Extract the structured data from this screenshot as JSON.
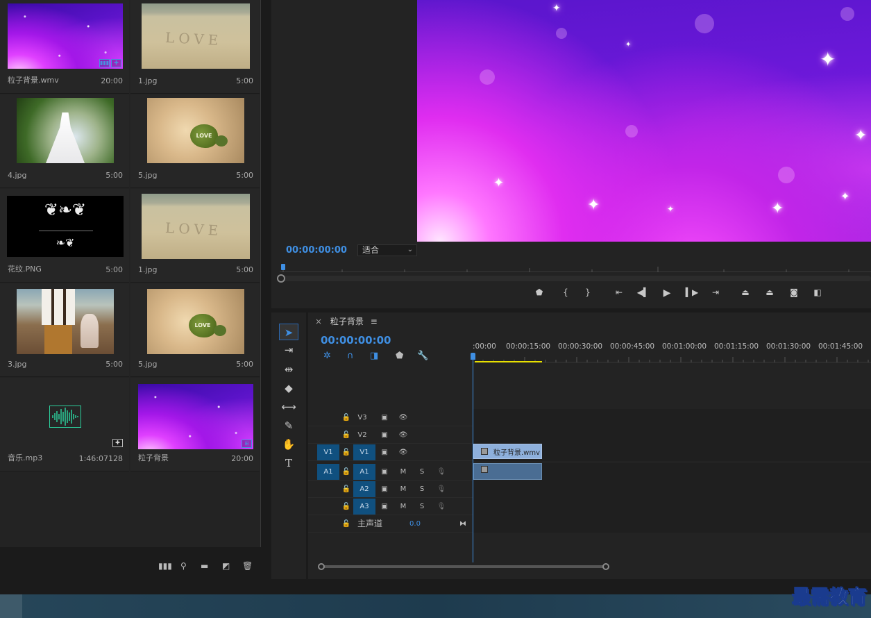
{
  "project": {
    "items": [
      {
        "name": "粒子背景.wmv",
        "duration": "20:00",
        "thumb": "purple",
        "badge": "video"
      },
      {
        "name": "1.jpg",
        "duration": "5:00",
        "thumb": "sand"
      },
      {
        "name": "4.jpg",
        "duration": "5:00",
        "thumb": "dress"
      },
      {
        "name": "5.jpg",
        "duration": "5:00",
        "thumb": "leaf"
      },
      {
        "name": "花纹.PNG",
        "duration": "5:00",
        "thumb": "black"
      },
      {
        "name": "1.jpg",
        "duration": "5:00",
        "thumb": "sand"
      },
      {
        "name": "3.jpg",
        "duration": "5:00",
        "thumb": "couple"
      },
      {
        "name": "5.jpg",
        "duration": "5:00",
        "thumb": "leaf"
      },
      {
        "name": "音乐.mp3",
        "duration": "1:46:07128",
        "thumb": "audio"
      },
      {
        "name": "粒子背景",
        "duration": "20:00",
        "thumb": "purple",
        "badge": "sequence"
      }
    ],
    "thumb_text": {
      "love": "LOVE"
    },
    "toolbar_icons": [
      "freeform-view-icon",
      "find-icon",
      "new-bin-icon",
      "new-item-icon",
      "clear-icon"
    ]
  },
  "program": {
    "timecode": "00:00:00:00",
    "fit": "适合"
  },
  "timeline": {
    "sequence_name": "粒子背景",
    "timecode": "00:00:00:00",
    "ruler_labels": [
      ":00:00",
      "00:00:15:00",
      "00:00:30:00",
      "00:00:45:00",
      "00:01:00:00",
      "00:01:15:00",
      "00:01:30:00",
      "00:01:45:00"
    ],
    "tracks": {
      "v3": "V3",
      "v2": "V2",
      "v1": "V1",
      "v1_target": "V1",
      "a1": "A1",
      "a1_target": "A1",
      "a2": "A2",
      "a3": "A3",
      "mute": "M",
      "solo": "S",
      "master": "主声道",
      "master_value": "0.0"
    },
    "clip_name": "粒子背景.wmv"
  },
  "watermark": "最需教育",
  "colors": {
    "accent": "#3f8fe3",
    "target": "#10507f",
    "video_clip": "#8eb0dc",
    "audio_clip": "#4a6d93"
  }
}
